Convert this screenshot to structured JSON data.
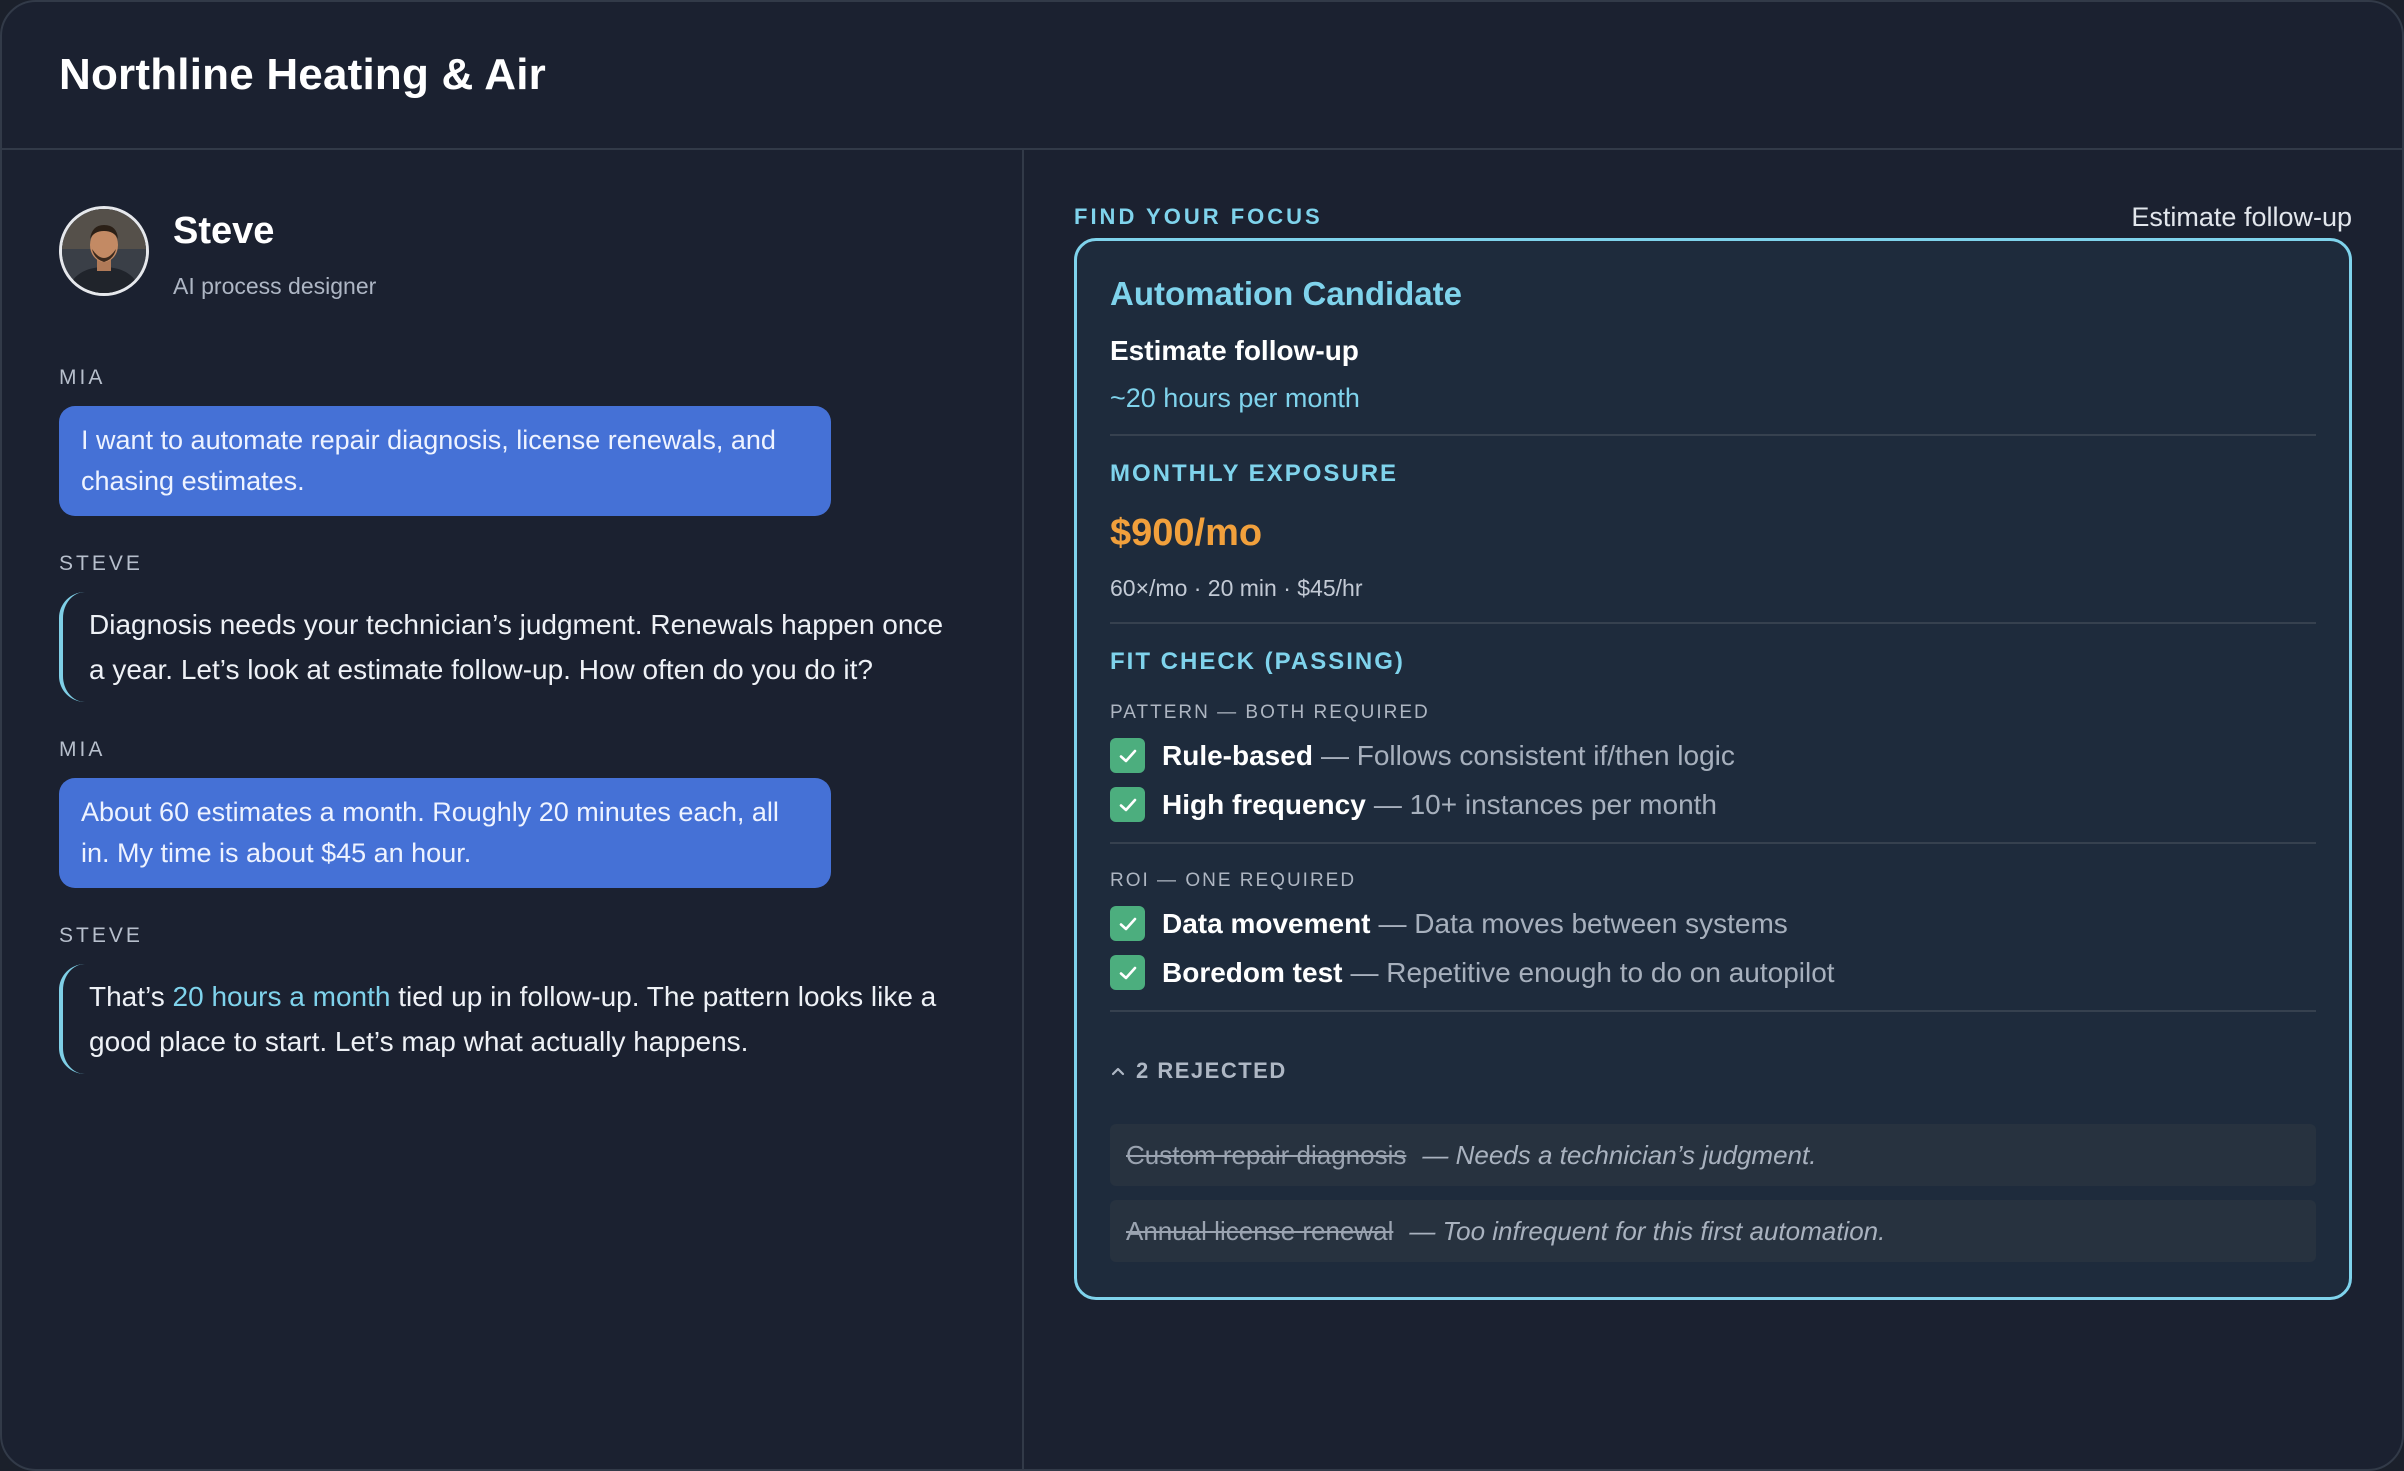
{
  "app": {
    "title": "Northline Heating & Air"
  },
  "persona": {
    "name": "Steve",
    "role": "AI process designer"
  },
  "conversation": [
    {
      "speaker": "MIA",
      "text": "I want to automate repair diagnosis, license renewals, and chasing estimates."
    },
    {
      "speaker": "STEVE",
      "text": "Diagnosis needs your technician’s judgment. Renewals happen once a year. Let’s look at estimate follow-up. How often do you do it?"
    },
    {
      "speaker": "MIA",
      "text": "About 60 estimates a month. Roughly 20 minutes each, all in. My time is about $45 an hour."
    },
    {
      "speaker": "STEVE",
      "text_before": "That’s ",
      "highlight": "20 hours a month",
      "text_after": " tied up in follow-up. The pattern looks like a good place to start. Let’s map what actually happens."
    }
  ],
  "focus": {
    "label": "FIND YOUR FOCUS",
    "current": "Estimate follow-up",
    "card_title": "Automation Candidate",
    "candidate_name": "Estimate follow-up",
    "candidate_hours": "~20 hours per month",
    "exposure_label": "MONTHLY EXPOSURE",
    "exposure_value": "$900/mo",
    "exposure_formula": "60×/mo · 20 min · $45/hr",
    "fit_label": "FIT CHECK (PASSING)",
    "pattern_label": "PATTERN — BOTH REQUIRED",
    "pattern_checks": [
      {
        "name": "Rule-based",
        "desc": "— Follows consistent if/then logic",
        "checked": true
      },
      {
        "name": "High frequency",
        "desc": "— 10+ instances per month",
        "checked": true
      }
    ],
    "roi_label": "ROI — ONE REQUIRED",
    "roi_checks": [
      {
        "name": "Data movement",
        "desc": "— Data moves between systems",
        "checked": true
      },
      {
        "name": "Boredom test",
        "desc": "— Repetitive enough to do on autopilot",
        "checked": true
      }
    ],
    "rejected_toggle": "2 REJECTED",
    "rejected": [
      {
        "name": "Custom repair diagnosis",
        "reason": "— Needs a technician’s judgment."
      },
      {
        "name": "Annual license renewal",
        "reason": "— Too infrequent for this first automation."
      }
    ]
  },
  "colors": {
    "accent": "#7fd3ec",
    "user_bubble": "#4571d6",
    "exposure": "#f1a03c",
    "check": "#4cae7e"
  },
  "icons": {
    "check": "check-icon",
    "chevron": "chevron-up-icon"
  }
}
